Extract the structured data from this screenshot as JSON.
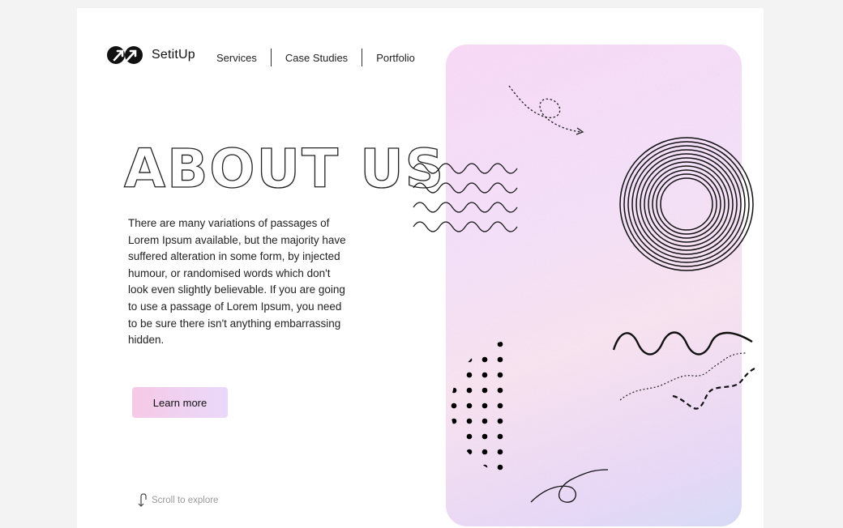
{
  "brand": {
    "name": "SetitUp",
    "logo_icon": "link-arrows-icon"
  },
  "nav": {
    "items": [
      "Services",
      "Case Studies",
      "Portfolio"
    ]
  },
  "hero": {
    "title": "ABOUT US",
    "body": "There are many variations of passages of Lorem Ipsum available, but the majority have suffered alteration in some form, by injected humour, or randomised words which don't look even slightly believable. If you are going to use a passage of Lorem Ipsum, you need to be sure there isn't anything embarrassing hidden.",
    "cta_label": "Learn more"
  },
  "scroll": {
    "label": "Scroll to explore",
    "icon": "scroll-arrow-icon"
  },
  "colors": {
    "card_top": "#f7d9f6",
    "card_bottom": "#d7dbf6",
    "button_from": "#f6c9e6",
    "button_to": "#ead9fb"
  }
}
